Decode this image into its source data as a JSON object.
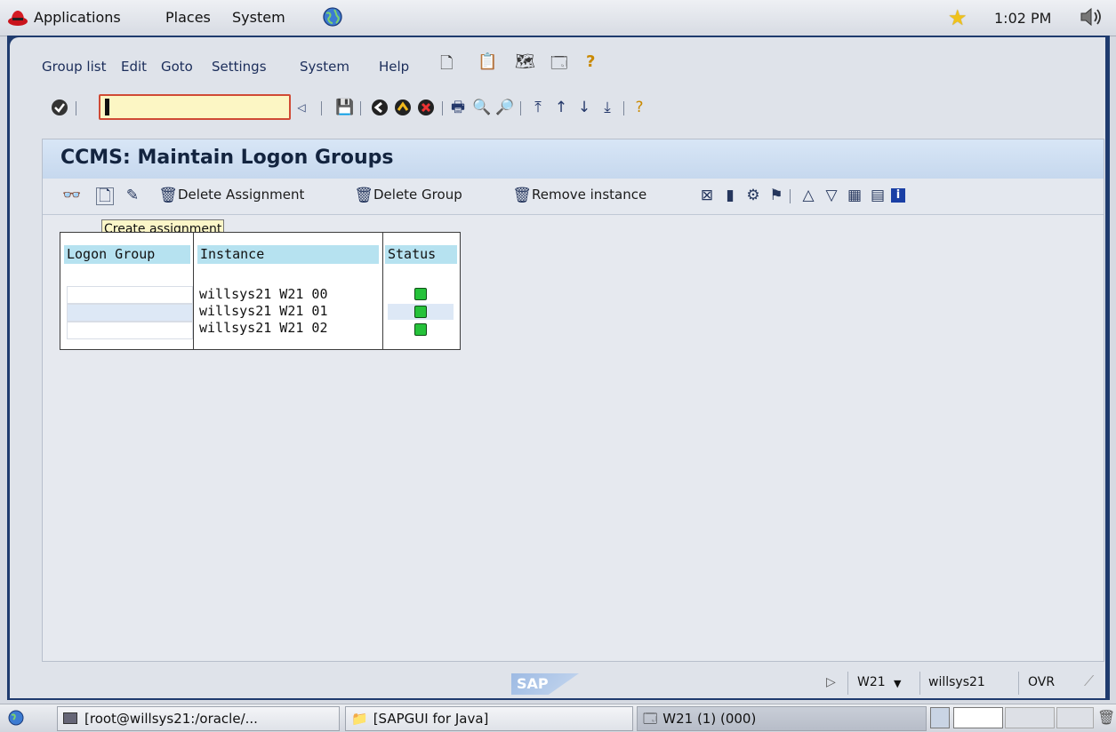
{
  "top_panel": {
    "menus": [
      "Applications",
      "Places",
      "System"
    ],
    "clock": "1:02 PM"
  },
  "menubar": {
    "items": [
      "Group list",
      "Edit",
      "Goto",
      "Settings",
      "System",
      "Help"
    ]
  },
  "toolbar": {
    "command_field_value": ""
  },
  "page": {
    "title": "CCMS: Maintain Logon Groups"
  },
  "app_toolbar": {
    "delete_assignment": "Delete Assignment",
    "delete_group": "Delete Group",
    "remove_instance": "Remove instance"
  },
  "tooltip": "Create assignment",
  "table": {
    "headers": [
      "Logon Group",
      "Instance",
      "Status"
    ],
    "rows": [
      {
        "logon_group": "",
        "instance": "willsys21 W21 00",
        "status": "green"
      },
      {
        "logon_group": "",
        "instance": "willsys21 W21 01",
        "status": "green"
      },
      {
        "logon_group": "",
        "instance": "willsys21 W21 02",
        "status": "green"
      }
    ]
  },
  "status_bar": {
    "logo": "SAP",
    "system": "W21",
    "host": "willsys21",
    "mode": "OVR"
  },
  "taskbar": {
    "tasks": [
      "[root@willsys21:/oracle/...",
      "[SAPGUI for Java]",
      "W21 (1) (000)"
    ]
  },
  "colors": {
    "window_frame": "#1f3b6e",
    "title_bar": "#c6d8ee",
    "header_cell": "#b6e2f0",
    "status_green": "#25c23a",
    "command_field": "#fcf6c4"
  }
}
